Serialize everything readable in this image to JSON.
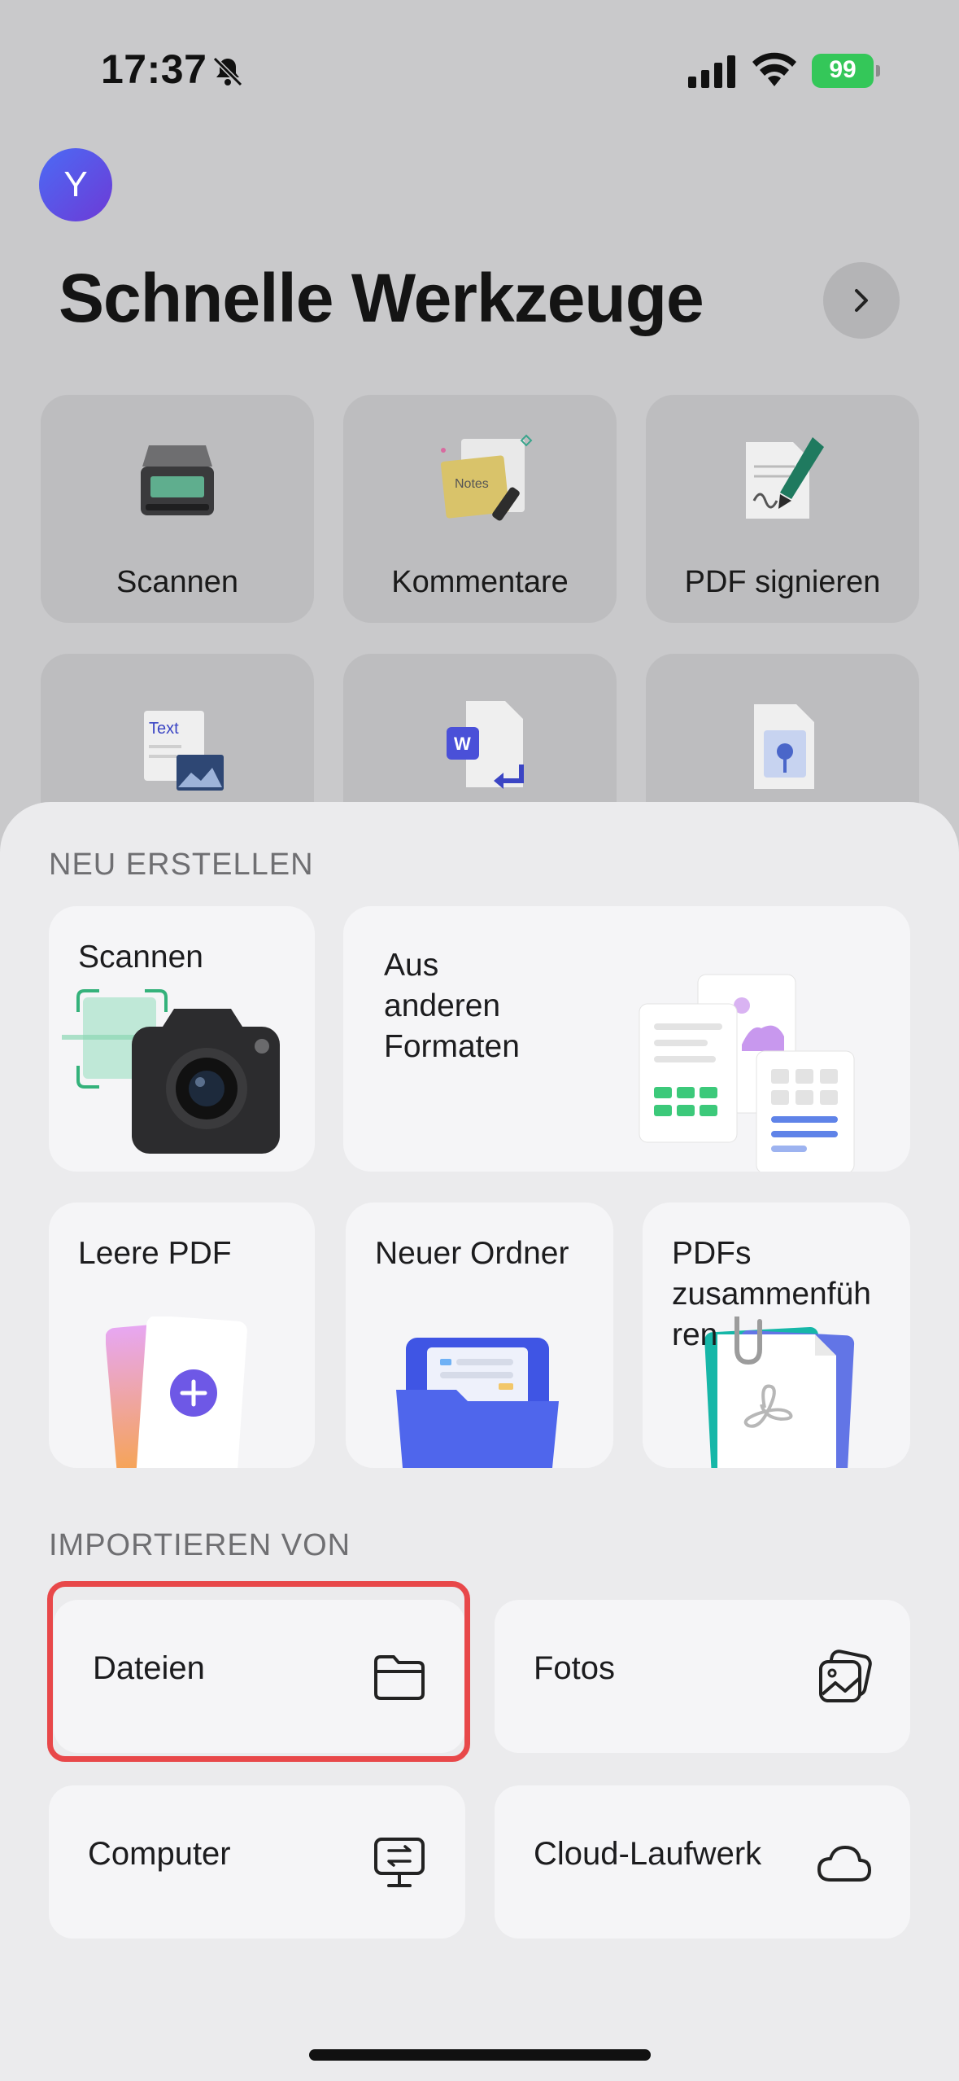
{
  "status_bar": {
    "time": "17:37",
    "battery": "99"
  },
  "header": {
    "avatar_initial": "Y",
    "title": "Schnelle Werkzeuge"
  },
  "quick_tools": [
    {
      "label": "Scannen"
    },
    {
      "label": "Kommentare"
    },
    {
      "label": "PDF signieren"
    },
    {
      "label": ""
    },
    {
      "label": ""
    },
    {
      "label": ""
    }
  ],
  "create_section": {
    "title": "NEU ERSTELLEN",
    "scan": "Scannen",
    "other_formats": "Aus\nanderen\nFormaten",
    "empty_pdf": "Leere PDF",
    "new_folder": "Neuer Ordner",
    "merge_pdfs": "PDFs\nzusammenfüh\nren"
  },
  "import_section": {
    "title": "IMPORTIEREN VON",
    "files": "Dateien",
    "photos": "Fotos",
    "computer": "Computer",
    "cloud": "Cloud-Laufwerk"
  },
  "colors": {
    "accent_highlight": "#e8484a",
    "battery": "#34c759",
    "avatar": "#5a4fe6"
  }
}
